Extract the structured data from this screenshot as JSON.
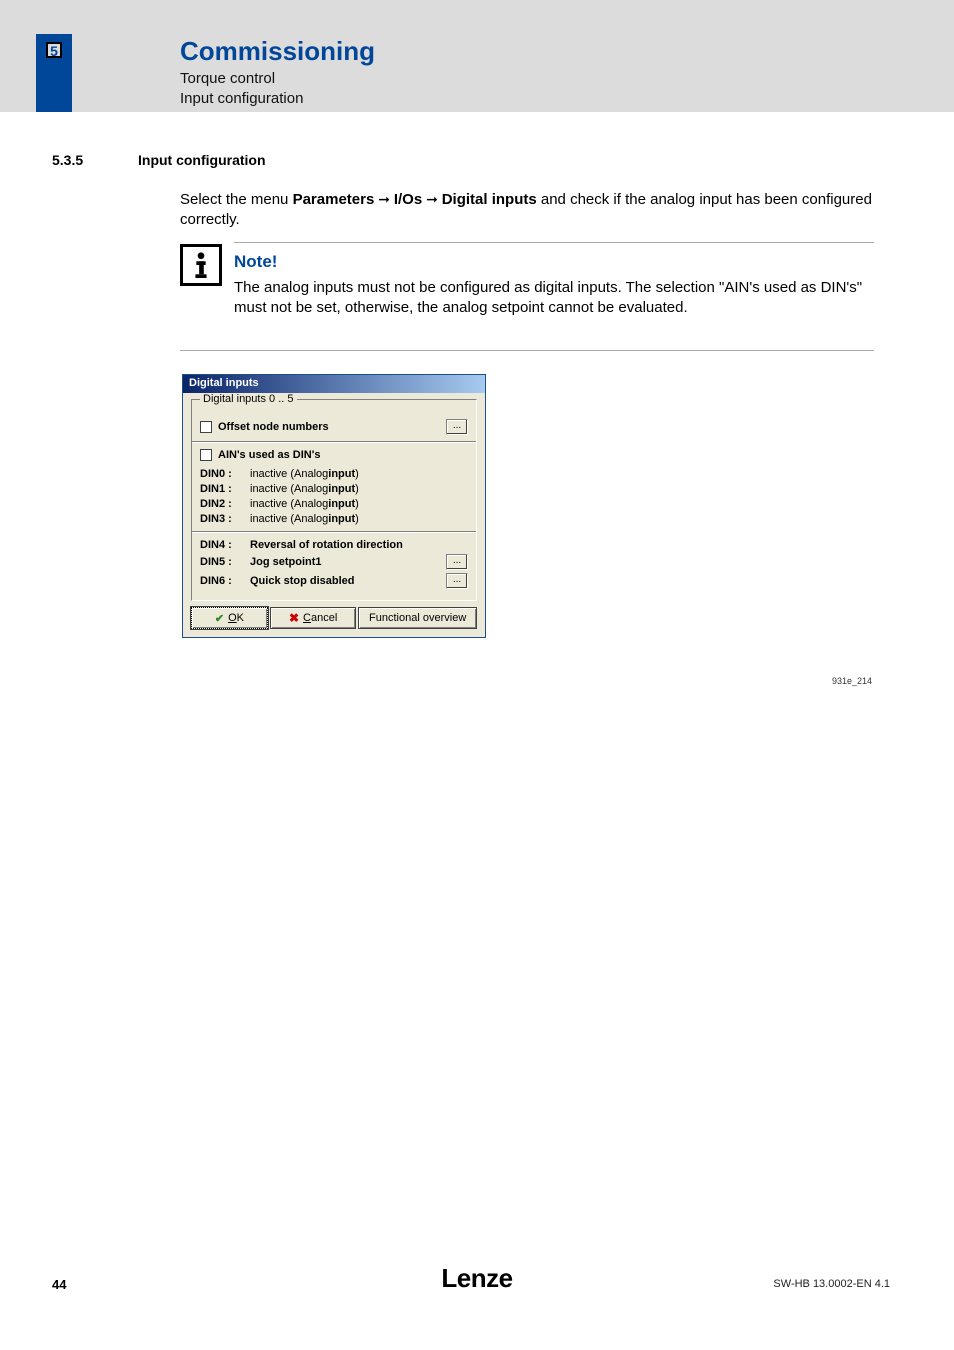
{
  "header": {
    "chapter_num": "5",
    "title": "Commissioning",
    "sub1": "Torque control",
    "sub2": "Input configuration"
  },
  "section": {
    "number": "5.3.5",
    "title": "Input configuration"
  },
  "paragraph": {
    "pre": "Select the menu ",
    "b1": "Parameters",
    "arr1": " ➞ ",
    "b2": "I/Os",
    "arr2": " ➞ ",
    "b3": "Digital inputs",
    "post": " and check if the analog input has been configured correctly."
  },
  "note": {
    "title": "Note!",
    "body": "The analog inputs must not be configured as digital inputs. The selection \"AIN's used as DIN's\" must not be set, otherwise, the analog setpoint cannot be evaluated."
  },
  "dialog": {
    "title": "Digital inputs",
    "group_legend": "Digital inputs  0 .. 5",
    "offset_label": "Offset node numbers",
    "ain_label": "AIN's used as DIN's",
    "rows_a": [
      {
        "name": "DIN0 :",
        "val_pre": "inactive (Analog",
        "val_bold": "input",
        "val_post": ")"
      },
      {
        "name": "DIN1 :",
        "val_pre": "inactive (Analog",
        "val_bold": "input",
        "val_post": ")"
      },
      {
        "name": "DIN2 :",
        "val_pre": "inactive (Analog",
        "val_bold": "input",
        "val_post": ")"
      },
      {
        "name": "DIN3 :",
        "val_pre": "inactive (Analog",
        "val_bold": "input",
        "val_post": ")"
      }
    ],
    "rows_b": [
      {
        "name": "DIN4 :",
        "val": "Reversal of rotation direction",
        "btn": false
      },
      {
        "name": "DIN5 :",
        "val": "Jog setpoint1",
        "btn": true
      },
      {
        "name": "DIN6 :",
        "val": "Quick stop disabled",
        "btn": true
      }
    ],
    "ok": "OK",
    "ok_u": "O",
    "cancel": "Cancel",
    "cancel_u": "C",
    "func": "Functional overview",
    "ellipsis": "..."
  },
  "figure_caption": "931e_214",
  "footer": {
    "page": "44",
    "logo": "Lenze",
    "doc": "SW-HB 13.0002-EN   4.1"
  }
}
